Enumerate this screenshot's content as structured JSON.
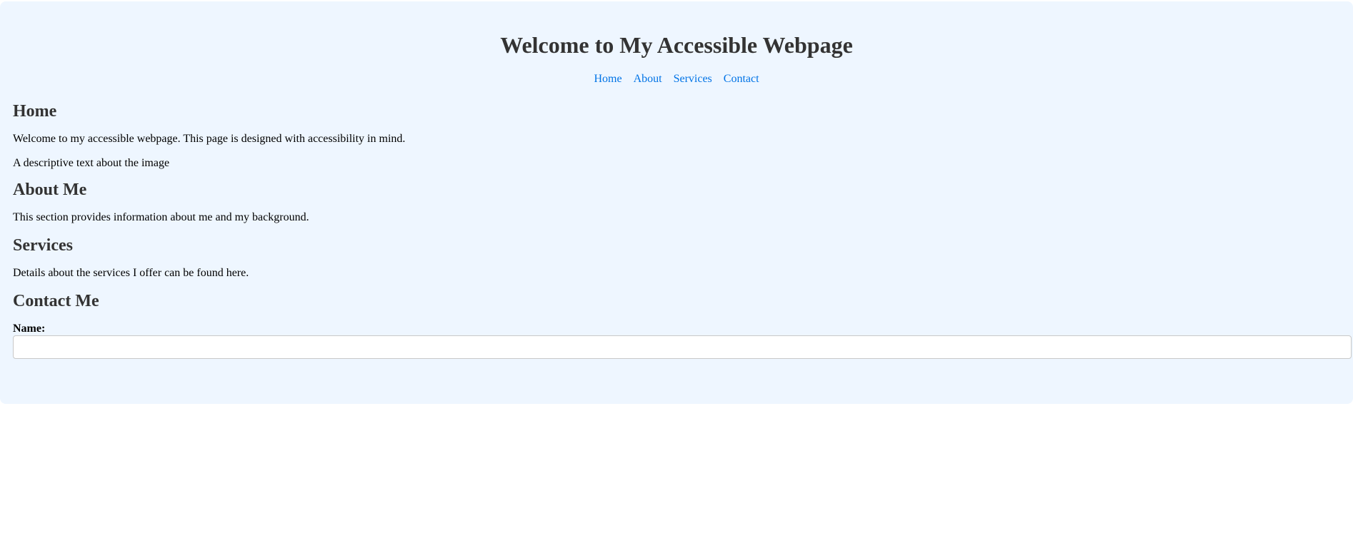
{
  "header": {
    "title": "Welcome to My Accessible Webpage",
    "nav": [
      "Home",
      "About",
      "Services",
      "Contact"
    ]
  },
  "home": {
    "heading": "Home",
    "text": "Welcome to my accessible webpage. This page is designed with accessibility in mind.",
    "image_alt": "A descriptive text about the image"
  },
  "about": {
    "heading": "About Me",
    "text": "This section provides information about me and my background."
  },
  "services": {
    "heading": "Services",
    "text": "Details about the services I offer can be found here."
  },
  "contact": {
    "heading": "Contact Me",
    "name_label": "Name:",
    "name_value": ""
  },
  "colors": {
    "page_bg": "#eef6ff",
    "heading": "#333333",
    "link": "#0073e6"
  }
}
